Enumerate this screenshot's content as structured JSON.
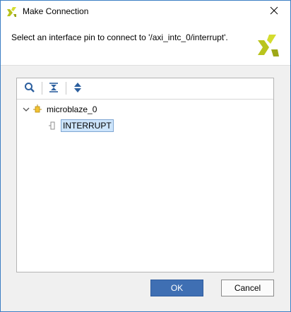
{
  "window": {
    "title": "Make Connection",
    "close_icon": "close-icon"
  },
  "header": {
    "instruction": "Select an interface pin to connect to '/axi_intc_0/interrupt'.",
    "logo_icon": "xilinx-logo"
  },
  "toolbar": {
    "buttons": [
      {
        "icon": "search-icon"
      },
      {
        "icon": "collapse-all-icon"
      },
      {
        "icon": "expand-all-icon"
      }
    ]
  },
  "tree": {
    "items": [
      {
        "label": "microblaze_0",
        "icon": "block-icon",
        "expanded": true
      },
      {
        "label": "INTERRUPT",
        "icon": "interface-pin-icon",
        "selected": true
      }
    ]
  },
  "footer": {
    "ok_label": "OK",
    "cancel_label": "Cancel"
  },
  "colors": {
    "accent": "#3f6fb3",
    "selection": "#cce4fb",
    "logo": "#c4cf1a"
  }
}
